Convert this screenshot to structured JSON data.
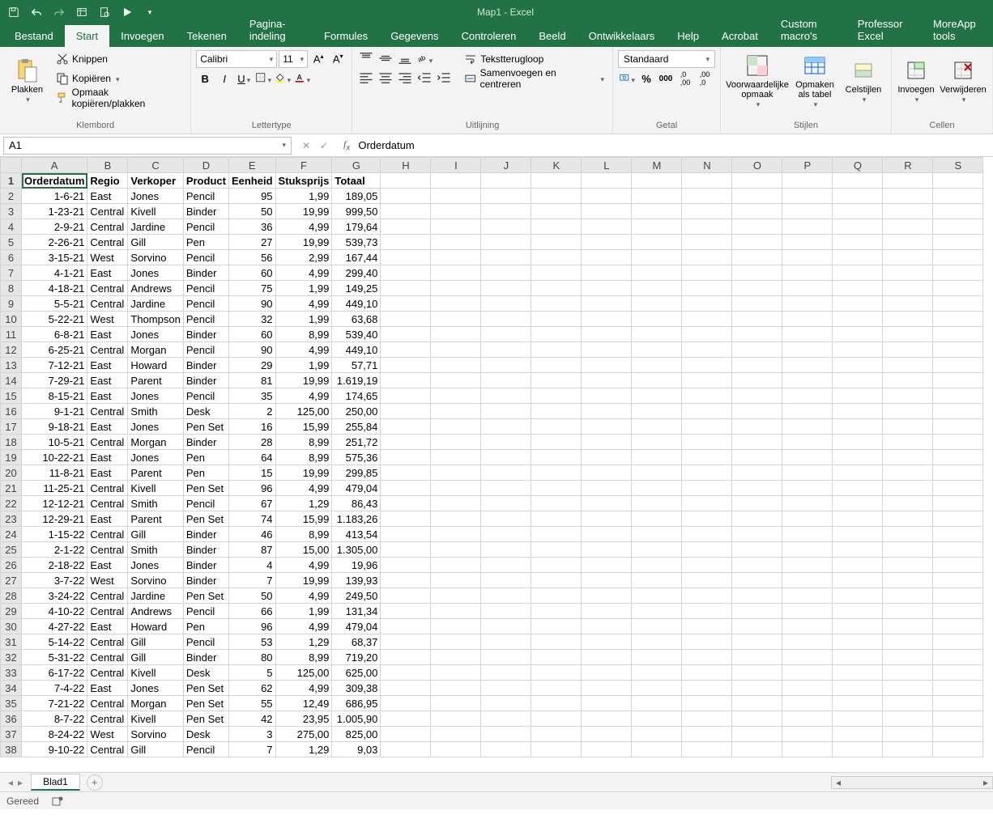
{
  "app": {
    "title": "Map1 - Excel"
  },
  "qat": {
    "save": "Save",
    "undo": "Undo",
    "redo": "Redo"
  },
  "tabs": {
    "file": "Bestand",
    "home": "Start",
    "insert": "Invoegen",
    "draw": "Tekenen",
    "layout": "Pagina-indeling",
    "formulas": "Formules",
    "data": "Gegevens",
    "review": "Controleren",
    "view": "Beeld",
    "dev": "Ontwikkelaars",
    "help": "Help",
    "acrobat": "Acrobat",
    "custom": "Custom macro's",
    "prof": "Professor Excel",
    "more": "MoreApp tools"
  },
  "ribbon": {
    "clipboard": {
      "paste": "Plakken",
      "cut": "Knippen",
      "copy": "Kopiëren",
      "format_painter": "Opmaak kopiëren/plakken",
      "label": "Klembord"
    },
    "font": {
      "name": "Calibri",
      "size": "11",
      "label": "Lettertype"
    },
    "alignment": {
      "wrap": "Tekstterugloop",
      "merge": "Samenvoegen en centreren",
      "label": "Uitlijning"
    },
    "number": {
      "format": "Standaard",
      "label": "Getal"
    },
    "styles": {
      "cond": "Voorwaardelijke opmaak",
      "table": "Opmaken als tabel",
      "cell": "Celstijlen",
      "label": "Stijlen"
    },
    "cells": {
      "insert": "Invoegen",
      "delete": "Verwijderen",
      "label": "Cellen"
    }
  },
  "namebox": "A1",
  "formula": "Orderdatum",
  "columns": [
    "A",
    "B",
    "C",
    "D",
    "E",
    "F",
    "G",
    "H",
    "I",
    "J",
    "K",
    "L",
    "M",
    "N",
    "O",
    "P",
    "Q",
    "R",
    "S"
  ],
  "headers": [
    "Orderdatum",
    "Regio",
    "Verkoper",
    "Product",
    "Eenheid",
    "Stuksprijs",
    "Totaal"
  ],
  "rows": [
    [
      "1-6-21",
      "East",
      "Jones",
      "Pencil",
      "95",
      "1,99",
      "189,05"
    ],
    [
      "1-23-21",
      "Central",
      "Kivell",
      "Binder",
      "50",
      "19,99",
      "999,50"
    ],
    [
      "2-9-21",
      "Central",
      "Jardine",
      "Pencil",
      "36",
      "4,99",
      "179,64"
    ],
    [
      "2-26-21",
      "Central",
      "Gill",
      "Pen",
      "27",
      "19,99",
      "539,73"
    ],
    [
      "3-15-21",
      "West",
      "Sorvino",
      "Pencil",
      "56",
      "2,99",
      "167,44"
    ],
    [
      "4-1-21",
      "East",
      "Jones",
      "Binder",
      "60",
      "4,99",
      "299,40"
    ],
    [
      "4-18-21",
      "Central",
      "Andrews",
      "Pencil",
      "75",
      "1,99",
      "149,25"
    ],
    [
      "5-5-21",
      "Central",
      "Jardine",
      "Pencil",
      "90",
      "4,99",
      "449,10"
    ],
    [
      "5-22-21",
      "West",
      "Thompson",
      "Pencil",
      "32",
      "1,99",
      "63,68"
    ],
    [
      "6-8-21",
      "East",
      "Jones",
      "Binder",
      "60",
      "8,99",
      "539,40"
    ],
    [
      "6-25-21",
      "Central",
      "Morgan",
      "Pencil",
      "90",
      "4,99",
      "449,10"
    ],
    [
      "7-12-21",
      "East",
      "Howard",
      "Binder",
      "29",
      "1,99",
      "57,71"
    ],
    [
      "7-29-21",
      "East",
      "Parent",
      "Binder",
      "81",
      "19,99",
      "1.619,19"
    ],
    [
      "8-15-21",
      "East",
      "Jones",
      "Pencil",
      "35",
      "4,99",
      "174,65"
    ],
    [
      "9-1-21",
      "Central",
      "Smith",
      "Desk",
      "2",
      "125,00",
      "250,00"
    ],
    [
      "9-18-21",
      "East",
      "Jones",
      "Pen Set",
      "16",
      "15,99",
      "255,84"
    ],
    [
      "10-5-21",
      "Central",
      "Morgan",
      "Binder",
      "28",
      "8,99",
      "251,72"
    ],
    [
      "10-22-21",
      "East",
      "Jones",
      "Pen",
      "64",
      "8,99",
      "575,36"
    ],
    [
      "11-8-21",
      "East",
      "Parent",
      "Pen",
      "15",
      "19,99",
      "299,85"
    ],
    [
      "11-25-21",
      "Central",
      "Kivell",
      "Pen Set",
      "96",
      "4,99",
      "479,04"
    ],
    [
      "12-12-21",
      "Central",
      "Smith",
      "Pencil",
      "67",
      "1,29",
      "86,43"
    ],
    [
      "12-29-21",
      "East",
      "Parent",
      "Pen Set",
      "74",
      "15,99",
      "1.183,26"
    ],
    [
      "1-15-22",
      "Central",
      "Gill",
      "Binder",
      "46",
      "8,99",
      "413,54"
    ],
    [
      "2-1-22",
      "Central",
      "Smith",
      "Binder",
      "87",
      "15,00",
      "1.305,00"
    ],
    [
      "2-18-22",
      "East",
      "Jones",
      "Binder",
      "4",
      "4,99",
      "19,96"
    ],
    [
      "3-7-22",
      "West",
      "Sorvino",
      "Binder",
      "7",
      "19,99",
      "139,93"
    ],
    [
      "3-24-22",
      "Central",
      "Jardine",
      "Pen Set",
      "50",
      "4,99",
      "249,50"
    ],
    [
      "4-10-22",
      "Central",
      "Andrews",
      "Pencil",
      "66",
      "1,99",
      "131,34"
    ],
    [
      "4-27-22",
      "East",
      "Howard",
      "Pen",
      "96",
      "4,99",
      "479,04"
    ],
    [
      "5-14-22",
      "Central",
      "Gill",
      "Pencil",
      "53",
      "1,29",
      "68,37"
    ],
    [
      "5-31-22",
      "Central",
      "Gill",
      "Binder",
      "80",
      "8,99",
      "719,20"
    ],
    [
      "6-17-22",
      "Central",
      "Kivell",
      "Desk",
      "5",
      "125,00",
      "625,00"
    ],
    [
      "7-4-22",
      "East",
      "Jones",
      "Pen Set",
      "62",
      "4,99",
      "309,38"
    ],
    [
      "7-21-22",
      "Central",
      "Morgan",
      "Pen Set",
      "55",
      "12,49",
      "686,95"
    ],
    [
      "8-7-22",
      "Central",
      "Kivell",
      "Pen Set",
      "42",
      "23,95",
      "1.005,90"
    ],
    [
      "8-24-22",
      "West",
      "Sorvino",
      "Desk",
      "3",
      "275,00",
      "825,00"
    ],
    [
      "9-10-22",
      "Central",
      "Gill",
      "Pencil",
      "7",
      "1,29",
      "9,03"
    ]
  ],
  "sheet": {
    "name": "Blad1"
  },
  "status": {
    "ready": "Gereed"
  }
}
